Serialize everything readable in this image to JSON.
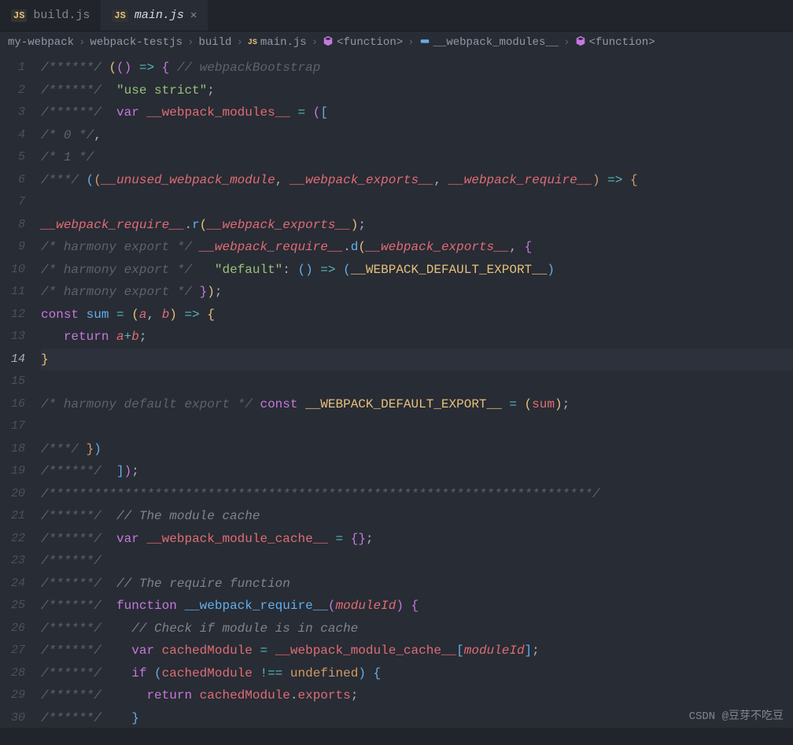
{
  "tabs": [
    {
      "icon": "JS",
      "label": "build.js",
      "active": false
    },
    {
      "icon": "JS",
      "label": "main.js",
      "active": true,
      "closable": true
    }
  ],
  "breadcrumb": [
    {
      "type": "text",
      "label": "my-webpack"
    },
    {
      "type": "text",
      "label": "webpack-testjs"
    },
    {
      "type": "text",
      "label": "build"
    },
    {
      "type": "file",
      "label": "main.js",
      "icon": "JS"
    },
    {
      "type": "sym",
      "label": "<function>",
      "icon": "cube"
    },
    {
      "type": "sym",
      "label": "__webpack_modules__",
      "icon": "field"
    },
    {
      "type": "sym",
      "label": "<function>",
      "icon": "cube"
    }
  ],
  "current_line": 14,
  "lines": [
    {
      "n": 1,
      "seg": [
        [
          "c1",
          "/******/ "
        ],
        [
          "y",
          "("
        ],
        [
          "pl",
          "("
        ],
        [
          "pl",
          ")"
        ],
        [
          "cy",
          " => "
        ],
        [
          "pl",
          "{"
        ],
        [
          "c1",
          " // webpackBootstrap"
        ]
      ]
    },
    {
      "n": 2,
      "seg": [
        [
          "c1",
          "/******/  "
        ],
        [
          "str",
          "\"use strict\""
        ],
        [
          "p",
          ";"
        ]
      ]
    },
    {
      "n": 3,
      "seg": [
        [
          "c1",
          "/******/  "
        ],
        [
          "kw",
          "var"
        ],
        [
          "p",
          " "
        ],
        [
          "varn",
          "__webpack_modules__"
        ],
        [
          "cy",
          " = "
        ],
        [
          "pl",
          "("
        ],
        [
          "bl",
          "["
        ]
      ]
    },
    {
      "n": 4,
      "seg": [
        [
          "c1",
          "/* 0 */"
        ],
        [
          "p",
          ","
        ]
      ]
    },
    {
      "n": 5,
      "seg": [
        [
          "c1",
          "/* 1 */"
        ]
      ]
    },
    {
      "n": 6,
      "seg": [
        [
          "c1",
          "/***/ "
        ],
        [
          "bl",
          "("
        ],
        [
          "gold",
          "("
        ],
        [
          "var",
          "__unused_webpack_module"
        ],
        [
          "p",
          ", "
        ],
        [
          "var",
          "__webpack_exports__"
        ],
        [
          "p",
          ", "
        ],
        [
          "var",
          "__webpack_require__"
        ],
        [
          "gold",
          ")"
        ],
        [
          "cy",
          " => "
        ],
        [
          "gold",
          "{"
        ]
      ]
    },
    {
      "n": 7,
      "seg": []
    },
    {
      "n": 8,
      "seg": [
        [
          "var",
          "__webpack_require__"
        ],
        [
          "p",
          "."
        ],
        [
          "fn",
          "r"
        ],
        [
          "y",
          "("
        ],
        [
          "var",
          "__webpack_exports__"
        ],
        [
          "y",
          ")"
        ],
        [
          "p",
          ";"
        ]
      ]
    },
    {
      "n": 9,
      "seg": [
        [
          "c1",
          "/* harmony export */ "
        ],
        [
          "var",
          "__webpack_require__"
        ],
        [
          "p",
          "."
        ],
        [
          "fn",
          "d"
        ],
        [
          "y",
          "("
        ],
        [
          "var",
          "__webpack_exports__"
        ],
        [
          "p",
          ", "
        ],
        [
          "pl",
          "{"
        ]
      ]
    },
    {
      "n": 10,
      "seg": [
        [
          "c1",
          "/* harmony export */   "
        ],
        [
          "str",
          "\"default\""
        ],
        [
          "p",
          ": "
        ],
        [
          "bl",
          "("
        ],
        [
          "bl",
          ")"
        ],
        [
          "cy",
          " => "
        ],
        [
          "bl",
          "("
        ],
        [
          "y",
          "__WEBPACK_DEFAULT_EXPORT__"
        ],
        [
          "bl",
          ")"
        ]
      ]
    },
    {
      "n": 11,
      "seg": [
        [
          "c1",
          "/* harmony export */ "
        ],
        [
          "pl",
          "}"
        ],
        [
          "y",
          ")"
        ],
        [
          "p",
          ";"
        ]
      ]
    },
    {
      "n": 12,
      "seg": [
        [
          "kw",
          "const"
        ],
        [
          "p",
          " "
        ],
        [
          "fn",
          "sum"
        ],
        [
          "cy",
          " = "
        ],
        [
          "y",
          "("
        ],
        [
          "var",
          "a"
        ],
        [
          "p",
          ", "
        ],
        [
          "var",
          "b"
        ],
        [
          "y",
          ")"
        ],
        [
          "cy",
          " => "
        ],
        [
          "y",
          "{"
        ]
      ]
    },
    {
      "n": 13,
      "seg": [
        [
          "p",
          "   "
        ],
        [
          "kw",
          "return"
        ],
        [
          "p",
          " "
        ],
        [
          "var",
          "a"
        ],
        [
          "cy",
          "+"
        ],
        [
          "var",
          "b"
        ],
        [
          "p",
          ";"
        ]
      ]
    },
    {
      "n": 14,
      "seg": [
        [
          "y",
          "}"
        ]
      ]
    },
    {
      "n": 15,
      "seg": []
    },
    {
      "n": 16,
      "seg": [
        [
          "c1",
          "/* harmony default export */ "
        ],
        [
          "kw",
          "const"
        ],
        [
          "p",
          " "
        ],
        [
          "y",
          "__WEBPACK_DEFAULT_EXPORT__"
        ],
        [
          "cy",
          " = "
        ],
        [
          "y",
          "("
        ],
        [
          "varn",
          "sum"
        ],
        [
          "y",
          ")"
        ],
        [
          "p",
          ";"
        ]
      ]
    },
    {
      "n": 17,
      "seg": []
    },
    {
      "n": 18,
      "seg": [
        [
          "c1",
          "/***/ "
        ],
        [
          "gold",
          "}"
        ],
        [
          "bl",
          ")"
        ]
      ]
    },
    {
      "n": 19,
      "seg": [
        [
          "c1",
          "/******/  "
        ],
        [
          "bl",
          "]"
        ],
        [
          "pl",
          ")"
        ],
        [
          "p",
          ";"
        ]
      ]
    },
    {
      "n": 20,
      "seg": [
        [
          "c1",
          "/************************************************************************/"
        ]
      ]
    },
    {
      "n": 21,
      "seg": [
        [
          "c1",
          "/******/  "
        ],
        [
          "c2",
          "// The module cache"
        ]
      ]
    },
    {
      "n": 22,
      "seg": [
        [
          "c1",
          "/******/  "
        ],
        [
          "kw",
          "var"
        ],
        [
          "p",
          " "
        ],
        [
          "varn",
          "__webpack_module_cache__"
        ],
        [
          "cy",
          " = "
        ],
        [
          "pl",
          "{"
        ],
        [
          "pl",
          "}"
        ],
        [
          "p",
          ";"
        ]
      ]
    },
    {
      "n": 23,
      "seg": [
        [
          "c1",
          "/******/"
        ]
      ]
    },
    {
      "n": 24,
      "seg": [
        [
          "c1",
          "/******/  "
        ],
        [
          "c2",
          "// The require function"
        ]
      ]
    },
    {
      "n": 25,
      "seg": [
        [
          "c1",
          "/******/  "
        ],
        [
          "kw",
          "function"
        ],
        [
          "p",
          " "
        ],
        [
          "fn",
          "__webpack_require__"
        ],
        [
          "pl",
          "("
        ],
        [
          "var",
          "moduleId"
        ],
        [
          "pl",
          ")"
        ],
        [
          "p",
          " "
        ],
        [
          "pl",
          "{"
        ]
      ]
    },
    {
      "n": 26,
      "seg": [
        [
          "c1",
          "/******/    "
        ],
        [
          "c2",
          "// Check if module is in cache"
        ]
      ]
    },
    {
      "n": 27,
      "seg": [
        [
          "c1",
          "/******/    "
        ],
        [
          "kw",
          "var"
        ],
        [
          "p",
          " "
        ],
        [
          "varn",
          "cachedModule"
        ],
        [
          "cy",
          " = "
        ],
        [
          "varn",
          "__webpack_module_cache__"
        ],
        [
          "bl",
          "["
        ],
        [
          "var",
          "moduleId"
        ],
        [
          "bl",
          "]"
        ],
        [
          "p",
          ";"
        ]
      ]
    },
    {
      "n": 28,
      "seg": [
        [
          "c1",
          "/******/    "
        ],
        [
          "kw",
          "if"
        ],
        [
          "p",
          " "
        ],
        [
          "bl",
          "("
        ],
        [
          "varn",
          "cachedModule"
        ],
        [
          "cy",
          " !== "
        ],
        [
          "gold",
          "undefined"
        ],
        [
          "bl",
          ")"
        ],
        [
          "p",
          " "
        ],
        [
          "bl",
          "{"
        ]
      ]
    },
    {
      "n": 29,
      "seg": [
        [
          "c1",
          "/******/      "
        ],
        [
          "kw",
          "return"
        ],
        [
          "p",
          " "
        ],
        [
          "varn",
          "cachedModule"
        ],
        [
          "p",
          "."
        ],
        [
          "varn",
          "exports"
        ],
        [
          "p",
          ";"
        ]
      ]
    },
    {
      "n": 30,
      "seg": [
        [
          "c1",
          "/******/    "
        ],
        [
          "bl",
          "}"
        ]
      ]
    }
  ],
  "watermark": "CSDN @豆芽不吃豆"
}
